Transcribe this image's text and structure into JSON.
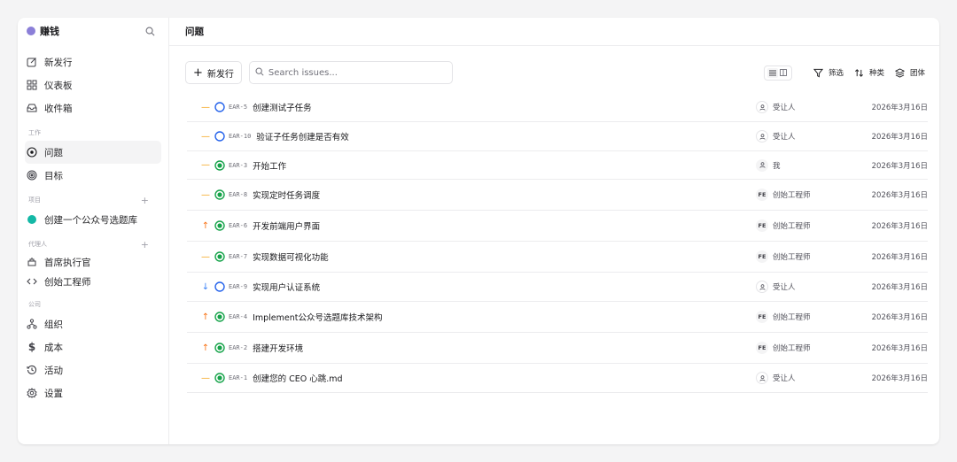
{
  "workspace": {
    "name": "赚钱",
    "dot_color": "#8b7fd8"
  },
  "sidebar": {
    "top_items": [
      {
        "label": "新发行",
        "icon": "edit-icon"
      },
      {
        "label": "仪表板",
        "icon": "dashboard-icon"
      },
      {
        "label": "收件箱",
        "icon": "inbox-icon"
      }
    ],
    "work_section": "工作",
    "work_items": [
      {
        "label": "问题",
        "icon": "issues-icon",
        "active": true
      },
      {
        "label": "目标",
        "icon": "target-icon"
      }
    ],
    "projects_section": "项目",
    "projects": [
      {
        "label": "创建一个公众号选题库",
        "color": "#14b8a6"
      }
    ],
    "agents_section": "代理人",
    "agents": [
      {
        "label": "首席执行官",
        "icon": "ceo-icon"
      },
      {
        "label": "创始工程师",
        "icon": "code-icon"
      }
    ],
    "company_section": "公司",
    "company_items": [
      {
        "label": "组织",
        "icon": "org-icon"
      },
      {
        "label": "成本",
        "icon": "dollar-icon"
      },
      {
        "label": "活动",
        "icon": "activity-icon"
      },
      {
        "label": "设置",
        "icon": "settings-icon"
      }
    ]
  },
  "header": {
    "title": "问题"
  },
  "toolbar": {
    "new_issue_label": "新发行",
    "search_placeholder": "Search issues...",
    "filter_label": "筛选",
    "sort_label": "种类",
    "group_label": "团体"
  },
  "issues": [
    {
      "priority": "medium",
      "priority_glyph": "—",
      "status": "todo",
      "id": "EAR-5",
      "title": "创建测试子任务",
      "assignee": "受让人",
      "assignee_type": "none",
      "date": "2026年3月16日"
    },
    {
      "priority": "medium",
      "priority_glyph": "—",
      "status": "todo",
      "id": "EAR-10",
      "title": "验证子任务创建是否有效",
      "assignee": "受让人",
      "assignee_type": "none",
      "date": "2026年3月16日"
    },
    {
      "priority": "medium",
      "priority_glyph": "—",
      "status": "in_progress",
      "id": "EAR-3",
      "title": "开始工作",
      "assignee": "我",
      "assignee_type": "me",
      "date": "2026年3月16日"
    },
    {
      "priority": "medium",
      "priority_glyph": "—",
      "status": "in_progress",
      "id": "EAR-8",
      "title": "实现定时任务调度",
      "assignee": "创始工程师",
      "assignee_initials": "FE",
      "assignee_type": "agent",
      "date": "2026年3月16日"
    },
    {
      "priority": "high",
      "priority_glyph": "↑",
      "status": "in_progress",
      "id": "EAR-6",
      "title": "开发前端用户界面",
      "assignee": "创始工程师",
      "assignee_initials": "FE",
      "assignee_type": "agent",
      "date": "2026年3月16日"
    },
    {
      "priority": "medium",
      "priority_glyph": "—",
      "status": "in_progress",
      "id": "EAR-7",
      "title": "实现数据可视化功能",
      "assignee": "创始工程师",
      "assignee_initials": "FE",
      "assignee_type": "agent",
      "date": "2026年3月16日"
    },
    {
      "priority": "low",
      "priority_glyph": "↓",
      "status": "todo",
      "id": "EAR-9",
      "title": "实现用户认证系统",
      "assignee": "受让人",
      "assignee_type": "none",
      "date": "2026年3月16日"
    },
    {
      "priority": "high",
      "priority_glyph": "↑",
      "status": "in_progress",
      "id": "EAR-4",
      "title": "Implement公众号选题库技术架构",
      "assignee": "创始工程师",
      "assignee_initials": "FE",
      "assignee_type": "agent",
      "date": "2026年3月16日"
    },
    {
      "priority": "high",
      "priority_glyph": "↑",
      "status": "in_progress",
      "id": "EAR-2",
      "title": "搭建开发环境",
      "assignee": "创始工程师",
      "assignee_initials": "FE",
      "assignee_type": "agent",
      "date": "2026年3月16日"
    },
    {
      "priority": "medium",
      "priority_glyph": "—",
      "status": "in_progress",
      "id": "EAR-1",
      "title": "创建您的 CEO 心跳.md",
      "assignee": "受让人",
      "assignee_type": "none",
      "date": "2026年3月16日"
    }
  ],
  "colors": {
    "todo": "#2563eb",
    "in_progress": "#16a34a",
    "medium": "#f59e0b",
    "high": "#f97316",
    "low": "#3b82f6"
  }
}
